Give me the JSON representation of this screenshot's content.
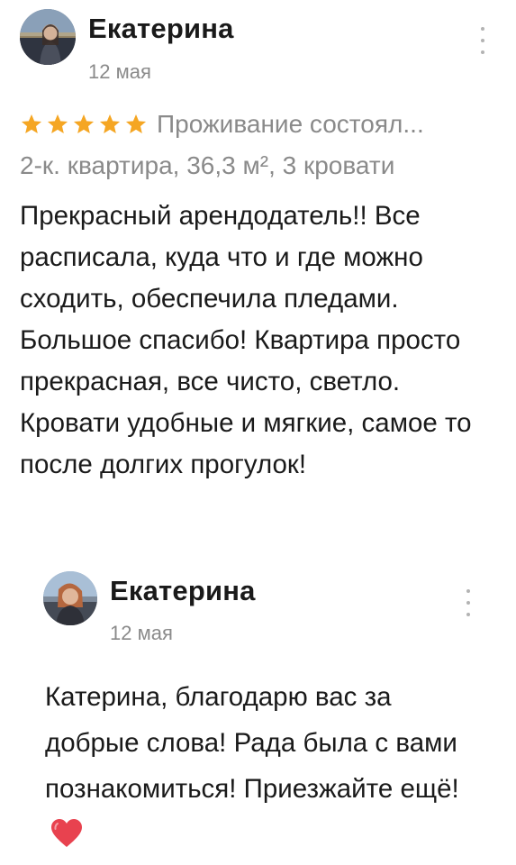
{
  "review": {
    "author": "Екатерина",
    "date": "12 мая",
    "rating": 5,
    "rating_max": 5,
    "rating_text": "Проживание состоял...",
    "listing": "2-к. квартира, 36,3 м², 3 кровати",
    "text": "Прекрасный арендодатель!! Все расписала, куда что и где можно сходить, обеспечила пледами. Большое спасибо! Квартира просто прекрасная, все чисто, светло. Кровати удобные и мягкие, самое то после долгих прогулок!"
  },
  "reply": {
    "author": "Екатерина",
    "date": "12 мая",
    "text": "Катерина, благодарю вас за добрые слова! Рада была с вами познакомиться! Приезжайте ещё!",
    "emoji": "heart-emoji"
  },
  "colors": {
    "star": "#f5a623",
    "secondary_text": "#8a8a8a",
    "primary_text": "#1a1a1a",
    "heart": "#e8424f",
    "menu_dots": "#b3b3b3"
  },
  "icons": {
    "menu": "vertical-ellipsis-icon",
    "star": "star-icon"
  }
}
